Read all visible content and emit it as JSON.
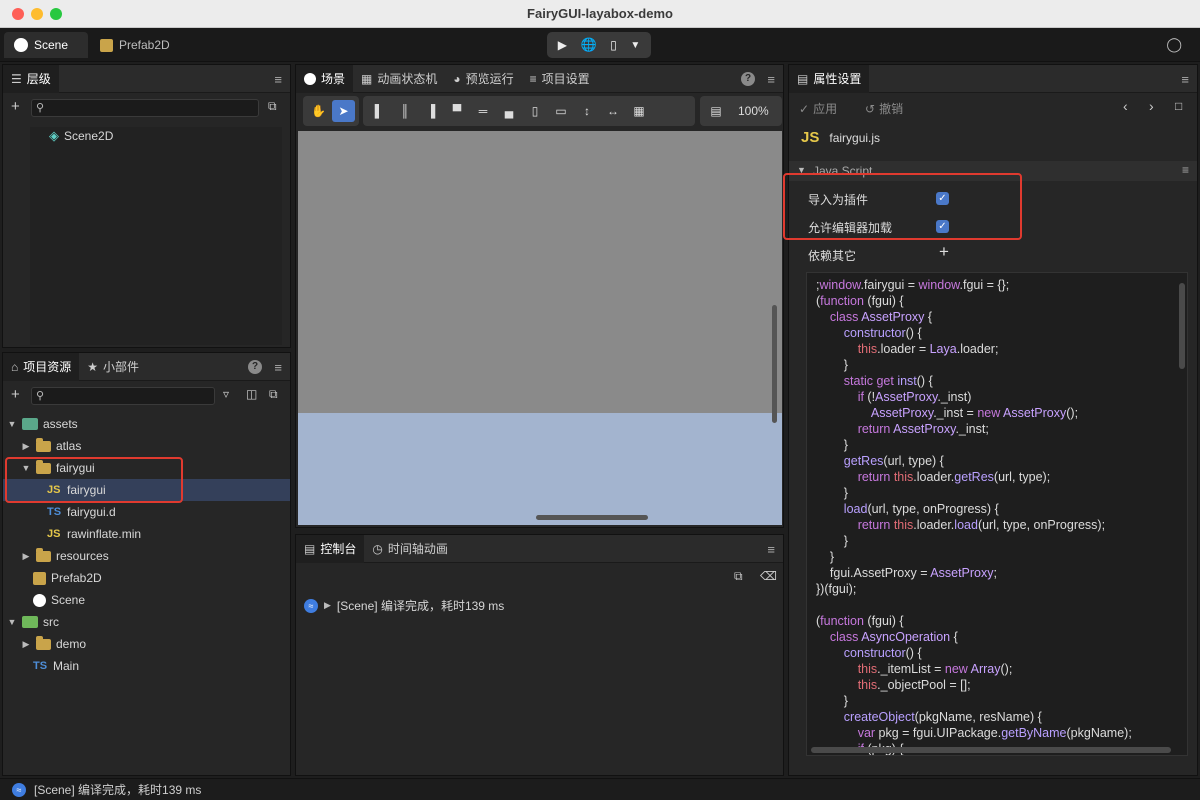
{
  "window": {
    "title": "FairyGUI-layabox-demo"
  },
  "top_tabs": [
    {
      "label": "Scene",
      "icon": "laya-scene-icon"
    },
    {
      "label": "Prefab2D",
      "icon": "prefab-box-icon"
    }
  ],
  "hierarchy": {
    "tab_label": "层级",
    "items": [
      {
        "label": "Scene2D",
        "icon": "cube-icon"
      }
    ]
  },
  "assets": {
    "tabs": [
      "项目资源",
      "小部件"
    ],
    "tree": [
      {
        "label": "assets",
        "type": "folder-root",
        "expanded": true
      },
      {
        "label": "atlas",
        "type": "folder",
        "expanded": false
      },
      {
        "label": "fairygui",
        "type": "folder",
        "expanded": true
      },
      {
        "label": "fairygui",
        "type": "js",
        "selected": true
      },
      {
        "label": "fairygui.d",
        "type": "ts"
      },
      {
        "label": "rawinflate.min",
        "type": "js"
      },
      {
        "label": "resources",
        "type": "folder",
        "expanded": false
      },
      {
        "label": "Prefab2D",
        "type": "prefab"
      },
      {
        "label": "Scene",
        "type": "scene"
      },
      {
        "label": "src",
        "type": "folder-root",
        "expanded": true
      },
      {
        "label": "demo",
        "type": "folder",
        "expanded": false
      },
      {
        "label": "Main",
        "type": "ts"
      }
    ]
  },
  "scene_panel": {
    "tabs": [
      "场景",
      "动画状态机",
      "预览运行",
      "项目设置"
    ],
    "zoom": "100%"
  },
  "console": {
    "tabs": [
      "控制台",
      "时间轴动画"
    ],
    "log": "[Scene] 编译完成，耗时139 ms"
  },
  "inspector": {
    "tab_label": "属性设置",
    "apply_label": "应用",
    "undo_label": "撤销",
    "file_name": "fairygui.js",
    "file_badge": "JS",
    "section_title": "Java Script",
    "options": [
      {
        "label": "导入为插件",
        "checked": true
      },
      {
        "label": "允许编辑器加载",
        "checked": true
      }
    ],
    "depends_label": "依赖其它"
  },
  "status_bar": {
    "text": "[Scene] 编译完成，耗时139 ms"
  },
  "colors": {
    "accent": "#4a78c8",
    "highlight_red": "#e03a2f",
    "scene_gray": "#8a8a8a",
    "scene_blue": "#a3b4cf"
  }
}
